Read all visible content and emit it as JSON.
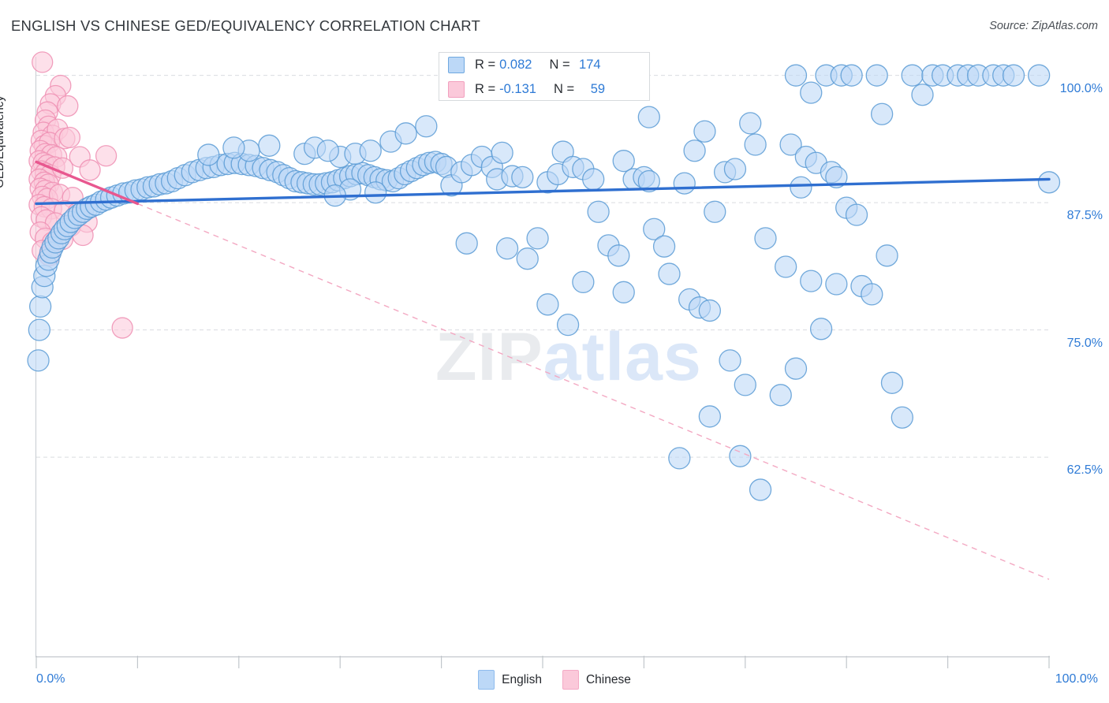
{
  "header": {
    "title": "ENGLISH VS CHINESE GED/EQUIVALENCY CORRELATION CHART",
    "source": "Source: ZipAtlas.com"
  },
  "watermark": {
    "part1": "ZIP",
    "part2": "atlas"
  },
  "stats": {
    "english": {
      "r_label": "R =",
      "r_value": "0.082",
      "n_label": "N =",
      "n_value": "174"
    },
    "chinese": {
      "r_label": "R =",
      "r_value": "-0.131",
      "n_label": "N =",
      "n_value": "59"
    }
  },
  "legend": {
    "english": "English",
    "chinese": "Chinese"
  },
  "chart_data": {
    "type": "scatter",
    "title": "ENGLISH VS CHINESE GED/EQUIVALENCY CORRELATION CHART",
    "xlabel": "",
    "ylabel": "GED/Equivalency",
    "xlim": [
      0,
      100
    ],
    "ylim": [
      43.0,
      101.6
    ],
    "grid": true,
    "xticks": [
      "0.0%",
      "100.0%"
    ],
    "yticks": [
      "100.0%",
      "87.5%",
      "75.0%",
      "62.5%"
    ],
    "ytick_values": [
      100.0,
      87.5,
      75.0,
      62.5
    ],
    "legend_position": "bottom-center",
    "series": [
      {
        "name": "English",
        "color": "#bcd8f7",
        "edge_color": "#5b9bd5",
        "r": 0.082,
        "n": 174,
        "trend": {
          "x0": 0,
          "y0": 87.4,
          "x1": 100,
          "y1": 89.8,
          "style": "solid",
          "color": "#2f6fd0"
        },
        "points": [
          [
            0.2,
            72.0
          ],
          [
            0.3,
            75.0
          ],
          [
            0.4,
            77.3
          ],
          [
            0.6,
            79.2
          ],
          [
            0.8,
            80.3
          ],
          [
            1.0,
            81.3
          ],
          [
            1.2,
            81.9
          ],
          [
            1.4,
            82.6
          ],
          [
            1.6,
            83.1
          ],
          [
            1.9,
            83.6
          ],
          [
            2.2,
            84.0
          ],
          [
            2.5,
            84.5
          ],
          [
            2.8,
            84.9
          ],
          [
            3.1,
            85.2
          ],
          [
            3.4,
            85.6
          ],
          [
            3.8,
            86.0
          ],
          [
            4.2,
            86.3
          ],
          [
            4.6,
            86.6
          ],
          [
            5.0,
            86.9
          ],
          [
            5.4,
            87.1
          ],
          [
            5.9,
            87.3
          ],
          [
            6.4,
            87.6
          ],
          [
            6.9,
            87.8
          ],
          [
            7.4,
            88.0
          ],
          [
            8.0,
            88.2
          ],
          [
            8.6,
            88.4
          ],
          [
            9.2,
            88.5
          ],
          [
            9.8,
            88.7
          ],
          [
            10.4,
            88.8
          ],
          [
            11.0,
            89.0
          ],
          [
            11.6,
            89.1
          ],
          [
            12.2,
            89.3
          ],
          [
            12.8,
            89.4
          ],
          [
            13.4,
            89.6
          ],
          [
            14.0,
            89.9
          ],
          [
            14.7,
            90.2
          ],
          [
            15.4,
            90.5
          ],
          [
            16.1,
            90.7
          ],
          [
            16.8,
            90.9
          ],
          [
            17.5,
            91.0
          ],
          [
            18.2,
            91.2
          ],
          [
            18.9,
            91.3
          ],
          [
            19.6,
            91.4
          ],
          [
            20.3,
            91.3
          ],
          [
            21.0,
            91.2
          ],
          [
            21.7,
            91.1
          ],
          [
            22.4,
            90.9
          ],
          [
            23.1,
            90.7
          ],
          [
            23.8,
            90.5
          ],
          [
            24.4,
            90.2
          ],
          [
            25.0,
            89.9
          ],
          [
            25.6,
            89.6
          ],
          [
            26.2,
            89.5
          ],
          [
            26.8,
            89.4
          ],
          [
            27.4,
            89.3
          ],
          [
            28.0,
            89.3
          ],
          [
            28.6,
            89.4
          ],
          [
            29.2,
            89.5
          ],
          [
            29.8,
            89.7
          ],
          [
            30.4,
            89.9
          ],
          [
            31.0,
            90.1
          ],
          [
            31.6,
            90.3
          ],
          [
            32.2,
            90.4
          ],
          [
            32.8,
            90.2
          ],
          [
            33.4,
            90.0
          ],
          [
            34.0,
            89.8
          ],
          [
            34.6,
            89.7
          ],
          [
            35.2,
            89.6
          ],
          [
            35.8,
            89.9
          ],
          [
            36.4,
            90.3
          ],
          [
            37.0,
            90.6
          ],
          [
            37.6,
            90.9
          ],
          [
            38.2,
            91.2
          ],
          [
            38.8,
            91.4
          ],
          [
            39.4,
            91.5
          ],
          [
            40.0,
            91.3
          ],
          [
            40.5,
            91.0
          ],
          [
            30.0,
            92.0
          ],
          [
            31.5,
            92.3
          ],
          [
            33.0,
            92.6
          ],
          [
            26.5,
            92.3
          ],
          [
            27.5,
            92.9
          ],
          [
            28.8,
            92.6
          ],
          [
            35.0,
            93.5
          ],
          [
            36.5,
            94.3
          ],
          [
            38.5,
            95.0
          ],
          [
            23.0,
            93.1
          ],
          [
            21.0,
            92.6
          ],
          [
            19.5,
            92.9
          ],
          [
            17.0,
            92.2
          ],
          [
            33.5,
            88.5
          ],
          [
            31.0,
            88.8
          ],
          [
            29.5,
            88.2
          ],
          [
            41.0,
            89.2
          ],
          [
            42.0,
            90.5
          ],
          [
            43.0,
            91.2
          ],
          [
            44.0,
            92.0
          ],
          [
            45.0,
            91.0
          ],
          [
            45.5,
            89.8
          ],
          [
            46.0,
            92.4
          ],
          [
            47.0,
            90.1
          ],
          [
            48.0,
            90.0
          ],
          [
            42.5,
            83.5
          ],
          [
            46.5,
            83.0
          ],
          [
            48.5,
            82.0
          ],
          [
            49.5,
            84.0
          ],
          [
            50.5,
            89.5
          ],
          [
            51.5,
            90.3
          ],
          [
            52.0,
            92.5
          ],
          [
            53.0,
            91.0
          ],
          [
            54.0,
            90.8
          ],
          [
            55.0,
            89.8
          ],
          [
            55.5,
            86.6
          ],
          [
            56.5,
            83.3
          ],
          [
            57.5,
            82.3
          ],
          [
            58.0,
            91.6
          ],
          [
            59.0,
            89.8
          ],
          [
            60.0,
            90.0
          ],
          [
            60.5,
            89.6
          ],
          [
            61.0,
            84.9
          ],
          [
            62.0,
            83.2
          ],
          [
            62.5,
            80.5
          ],
          [
            54.0,
            79.7
          ],
          [
            50.5,
            77.5
          ],
          [
            52.5,
            75.5
          ],
          [
            58.0,
            78.7
          ],
          [
            64.0,
            89.4
          ],
          [
            65.0,
            92.6
          ],
          [
            66.0,
            94.5
          ],
          [
            67.0,
            86.6
          ],
          [
            64.5,
            78.0
          ],
          [
            65.5,
            77.2
          ],
          [
            66.5,
            76.9
          ],
          [
            63.5,
            62.4
          ],
          [
            60.5,
            95.9
          ],
          [
            68.0,
            90.5
          ],
          [
            69.0,
            90.8
          ],
          [
            70.5,
            95.3
          ],
          [
            71.0,
            93.2
          ],
          [
            72.0,
            84.0
          ],
          [
            68.5,
            72.0
          ],
          [
            70.0,
            69.6
          ],
          [
            69.5,
            62.6
          ],
          [
            71.5,
            59.3
          ],
          [
            66.5,
            66.5
          ],
          [
            75.0,
            100.0
          ],
          [
            78.0,
            100.0
          ],
          [
            79.5,
            100.0
          ],
          [
            80.5,
            100.0
          ],
          [
            83.0,
            100.0
          ],
          [
            76.5,
            98.3
          ],
          [
            83.5,
            96.2
          ],
          [
            74.5,
            93.2
          ],
          [
            76.0,
            92.0
          ],
          [
            77.0,
            91.4
          ],
          [
            75.5,
            89.0
          ],
          [
            78.5,
            90.5
          ],
          [
            79.0,
            90.0
          ],
          [
            80.0,
            87.0
          ],
          [
            81.0,
            86.3
          ],
          [
            74.0,
            81.2
          ],
          [
            76.5,
            79.8
          ],
          [
            79.0,
            79.5
          ],
          [
            81.5,
            79.3
          ],
          [
            82.5,
            78.5
          ],
          [
            77.5,
            75.1
          ],
          [
            75.0,
            71.2
          ],
          [
            73.5,
            68.6
          ],
          [
            84.5,
            69.8
          ],
          [
            85.5,
            66.4
          ],
          [
            86.5,
            100.0
          ],
          [
            88.5,
            100.0
          ],
          [
            89.5,
            100.0
          ],
          [
            91.0,
            100.0
          ],
          [
            92.0,
            100.0
          ],
          [
            93.0,
            100.0
          ],
          [
            94.5,
            100.0
          ],
          [
            95.5,
            100.0
          ],
          [
            96.5,
            100.0
          ],
          [
            99.0,
            100.0
          ],
          [
            87.5,
            98.1
          ],
          [
            84.0,
            82.3
          ],
          [
            100.0,
            89.5
          ]
        ]
      },
      {
        "name": "Chinese",
        "color": "#fbc9da",
        "edge_color": "#ef8fb3",
        "r": -0.131,
        "n": 59,
        "trend": {
          "x0": 0,
          "y0": 91.5,
          "x1": 10,
          "y1": 87.4,
          "style": "solid",
          "color": "#e8578f"
        },
        "trend_extension": {
          "x0": 10,
          "y0": 87.4,
          "x1": 100,
          "y1": 50.5,
          "style": "dashed",
          "color": "#f3a8c2"
        },
        "points": [
          [
            0.6,
            101.3
          ],
          [
            2.4,
            99.0
          ],
          [
            1.9,
            98.0
          ],
          [
            1.4,
            97.2
          ],
          [
            1.1,
            96.4
          ],
          [
            3.1,
            97.0
          ],
          [
            0.9,
            95.6
          ],
          [
            1.2,
            95.0
          ],
          [
            0.7,
            94.4
          ],
          [
            1.6,
            94.1
          ],
          [
            2.1,
            94.7
          ],
          [
            0.5,
            93.6
          ],
          [
            0.8,
            93.1
          ],
          [
            1.3,
            93.4
          ],
          [
            2.8,
            93.8
          ],
          [
            3.3,
            93.9
          ],
          [
            0.4,
            92.6
          ],
          [
            0.9,
            92.3
          ],
          [
            1.5,
            92.2
          ],
          [
            2.0,
            92.0
          ],
          [
            0.3,
            91.6
          ],
          [
            0.7,
            91.4
          ],
          [
            1.1,
            91.2
          ],
          [
            1.8,
            91.0
          ],
          [
            4.3,
            92.0
          ],
          [
            6.9,
            92.1
          ],
          [
            0.5,
            90.6
          ],
          [
            0.9,
            90.4
          ],
          [
            1.4,
            90.2
          ],
          [
            0.3,
            89.8
          ],
          [
            0.8,
            89.5
          ],
          [
            1.2,
            89.3
          ],
          [
            2.6,
            90.9
          ],
          [
            5.3,
            90.7
          ],
          [
            0.4,
            88.9
          ],
          [
            0.9,
            88.7
          ],
          [
            1.6,
            88.5
          ],
          [
            0.6,
            88.1
          ],
          [
            1.1,
            87.9
          ],
          [
            2.3,
            88.3
          ],
          [
            3.6,
            88.0
          ],
          [
            0.3,
            87.3
          ],
          [
            0.8,
            87.1
          ],
          [
            1.5,
            86.9
          ],
          [
            2.8,
            86.7
          ],
          [
            4.1,
            86.5
          ],
          [
            0.5,
            86.1
          ],
          [
            1.0,
            85.8
          ],
          [
            1.9,
            85.5
          ],
          [
            3.4,
            85.2
          ],
          [
            5.0,
            85.6
          ],
          [
            0.4,
            84.6
          ],
          [
            0.9,
            84.0
          ],
          [
            1.6,
            83.6
          ],
          [
            0.6,
            82.8
          ],
          [
            1.3,
            82.3
          ],
          [
            2.6,
            83.9
          ],
          [
            4.6,
            84.3
          ],
          [
            8.5,
            75.2
          ]
        ]
      }
    ]
  }
}
